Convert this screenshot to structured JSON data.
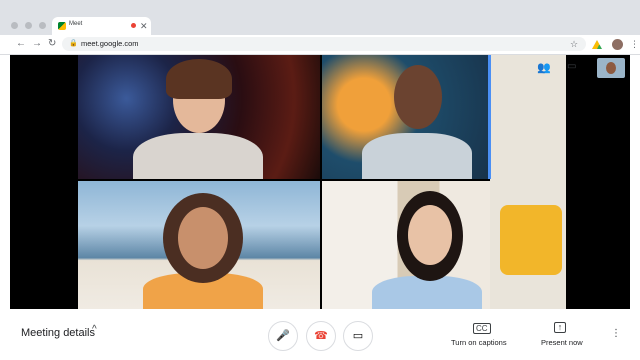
{
  "browser": {
    "tab_title": "Meet",
    "tab_close": "✕",
    "url": "meet.google.com",
    "back": "←",
    "forward": "→",
    "reload": "↻",
    "lock": "🔒",
    "star": "☆",
    "menu": "⋮"
  },
  "meet": {
    "participants_icon": "👥",
    "chat_icon": "▭"
  },
  "controls": {
    "meeting_details": "Meeting details",
    "details_chevron": "^",
    "mic_icon": "🎤",
    "hangup_icon": "☎",
    "camera_icon": "▭",
    "captions_icon": "CC",
    "captions_label": "Turn on captions",
    "present_icon": "↑",
    "present_label": "Present now",
    "more_icon": "⋮"
  },
  "colors": {
    "hangup": "#ea4335",
    "speaking_outline": "#4a8ff5",
    "tab_strip": "#dee1e6"
  }
}
